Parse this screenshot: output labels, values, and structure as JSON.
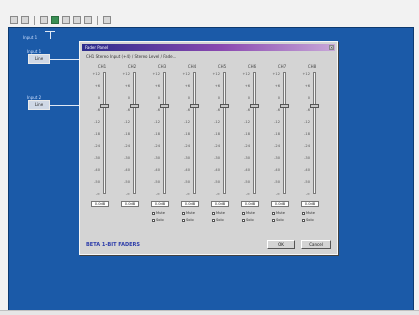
{
  "window": {
    "title": "Fader Panel",
    "caption": "CH1 Stereo Input (+4) / Stereo Level / Fade...",
    "close_glyph": "×"
  },
  "canvas_nodes": [
    {
      "caption": "Input 1",
      "label": "Line"
    },
    {
      "caption": "Input 2",
      "label": "Line"
    }
  ],
  "channels": [
    {
      "label": "CH1",
      "readout": "0.0dB",
      "level": 0.73,
      "options": []
    },
    {
      "label": "CH2",
      "readout": "0.0dB",
      "level": 0.73,
      "options": []
    },
    {
      "label": "CH3",
      "readout": "0.0dB",
      "level": 0.73,
      "options": [
        "Mute",
        "Solo"
      ]
    },
    {
      "label": "CH4",
      "readout": "0.0dB",
      "level": 0.73,
      "options": [
        "Mute",
        "Solo"
      ]
    },
    {
      "label": "CH5",
      "readout": "0.0dB",
      "level": 0.73,
      "options": [
        "Mute",
        "Solo"
      ]
    },
    {
      "label": "CH6",
      "readout": "0.0dB",
      "level": 0.73,
      "options": [
        "Mute",
        "Solo"
      ]
    },
    {
      "label": "CH7",
      "readout": "0.0dB",
      "level": 0.73,
      "options": [
        "Mute",
        "Solo"
      ]
    },
    {
      "label": "CH8",
      "readout": "0.0dB",
      "level": 0.73,
      "options": [
        "Mute",
        "Solo"
      ]
    }
  ],
  "scale_ticks": [
    "+12",
    "+6",
    "0",
    "-6",
    "-12",
    "-18",
    "-24",
    "-30",
    "-40",
    "-50",
    "-∞"
  ],
  "footer": {
    "brand": "BETA 1-BIT FADERS",
    "ok_label": "OK",
    "cancel_label": "Cancel"
  },
  "colors": {
    "desktop": "#1b5aa8",
    "title_start": "#2c2c8c",
    "title_end": "#8a48b0",
    "brand": "#2a3aa8"
  }
}
